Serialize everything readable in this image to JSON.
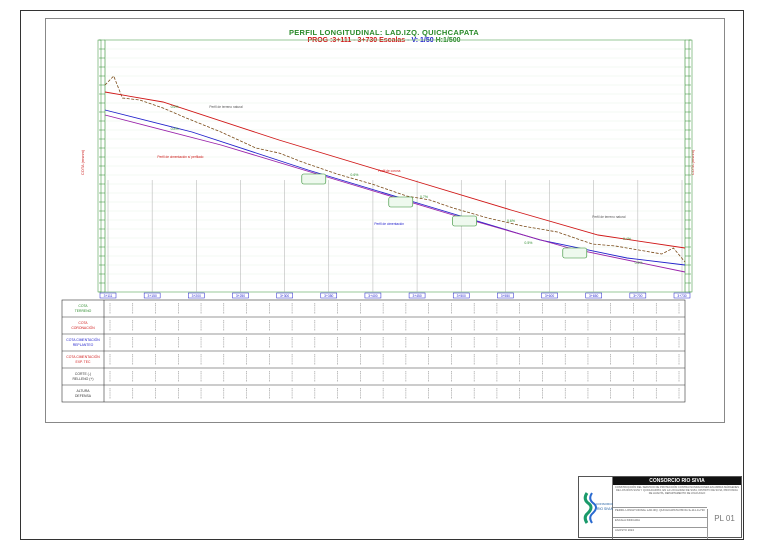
{
  "title": {
    "main": "PERFIL LONGITUDINAL: LAD.IZQ. QUICHCAPATA",
    "prog": "PROG :3+111 - 3+730",
    "scale_label": "Escalas",
    "scale_v": "- V: 1/50",
    "scale_h": "H:1/500"
  },
  "axis_labels": {
    "left": "COTA (msnm)",
    "right": "COTA (msnm)"
  },
  "annotations": {
    "terreno_top": "Perfil de terreno natural",
    "terreno_bottom": "Perfil de terreno natural",
    "cimentacion": "Perfil de cimentación s/ perfilado",
    "corona": "Perfil de corona",
    "fondo": "Perfil de cimentación"
  },
  "row_labels": [
    "COTA TERRENO",
    "COTA CORONACIÓN",
    "COTA CIMENTACIÓN REPLANTEO",
    "COTA CIMENTACIÓN EXP. TEC",
    "CORTE (-) RELLENO (+)",
    "ALTURA DEFENSA"
  ],
  "stations": [
    "3+111",
    "3+150",
    "3+200",
    "3+250",
    "3+300",
    "3+350",
    "3+400",
    "3+450",
    "3+500",
    "3+550",
    "3+600",
    "3+650",
    "3+700",
    "3+730"
  ],
  "slopes": [
    "0.6%",
    "0.8%",
    "0.6%",
    "0.7%",
    "0.6%",
    "0.5%",
    "0.4%",
    "0.6%"
  ],
  "title_block": {
    "company": "CONSORCIO RIO SIVIA",
    "description": "CONSTRUCCIÓN DEL SERVICIO DE PROTECCIÓN CONTRA INUNDACIONES EN AMBAS MÁRGENES DE LOS RÍOS SIVIA Y QUICHCAPATA, EN LA LOCALIDAD DE SIVIA, DISTRITO DE SIVIA, PROVINCIA DE HUANTA, DEPARTAMENTO DE AYACUCHO",
    "sheet_title": "PERFIL LONGITUDINAL LAD.IZQ. QUICHCAPATA PROG:3+111-3+730",
    "scale": "ESCALA INDICADA",
    "date": "AGOSTO 2024",
    "sheet": "PL 01"
  },
  "colors": {
    "grid_green": "#2a8a2a",
    "terrain": "#7a4a18",
    "corona": "#d01818",
    "cimentacion": "#2222cc",
    "fondo": "#9922aa"
  }
}
